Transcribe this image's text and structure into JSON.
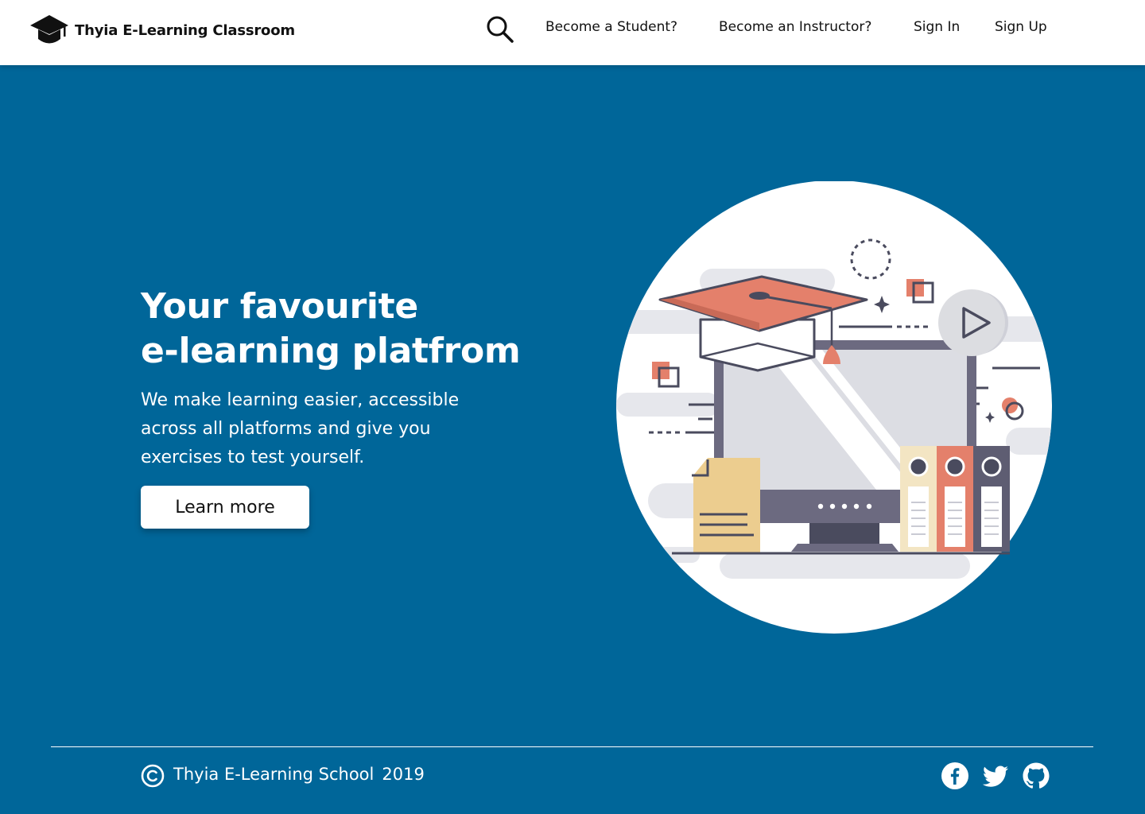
{
  "navbar": {
    "brand": "Thyia E-Learning Classroom",
    "links": {
      "student": "Become a Student?",
      "instructor": "Become an Instructor?",
      "sign_in": "Sign In",
      "sign_up": "Sign Up"
    },
    "icons": {
      "logo": "graduation-cap-icon",
      "search": "search-icon"
    }
  },
  "hero": {
    "title_line1": "Your favourite",
    "title_line2": "e-learning platfrom",
    "description": "We make learning easier, accessible across all platforms and give you exercises to test yourself.",
    "cta_label": "Learn more"
  },
  "footer": {
    "copyright_text": "Thyia E-Learning School",
    "year": "2019",
    "icons": [
      "copyright-icon",
      "facebook-icon",
      "twitter-icon",
      "github-icon"
    ]
  },
  "colors": {
    "background": "#006699",
    "navbar": "#ffffff",
    "text_dark": "#111111",
    "accent_salmon": "#e4806b",
    "accent_sand": "#eccd8f",
    "illustration_dark": "#4a4b5e"
  }
}
